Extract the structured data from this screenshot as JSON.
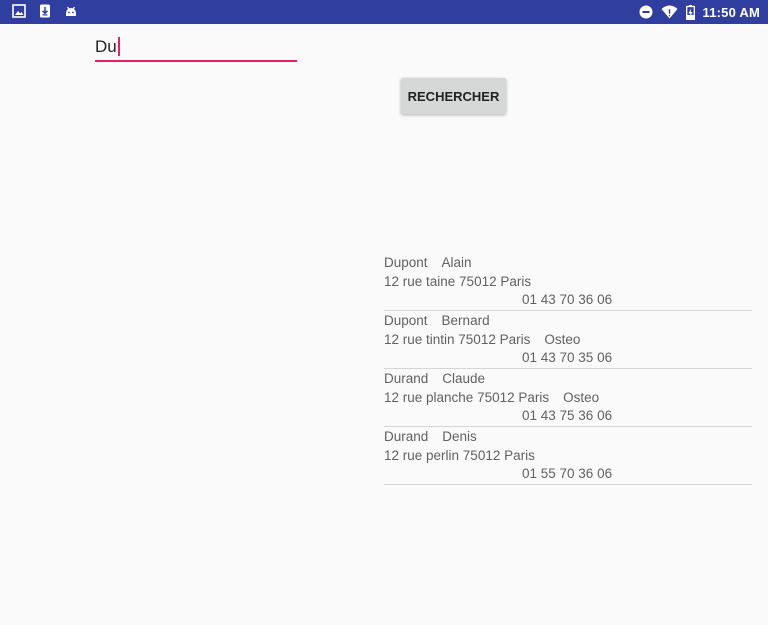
{
  "status_bar": {
    "time": "11:50 AM",
    "left_icons": [
      "image-icon",
      "download-icon",
      "android-icon"
    ],
    "right_icons": [
      "do-not-disturb-icon",
      "wifi-icon",
      "battery-charging-icon"
    ]
  },
  "search": {
    "value": "Du",
    "placeholder": ""
  },
  "button": {
    "label": "RECHERCHER"
  },
  "results": [
    {
      "last_name": "Dupont",
      "first_name": "Alain",
      "address": "12 rue taine 75012 Paris",
      "specialty": "",
      "phone": "01 43 70 36 06"
    },
    {
      "last_name": "Dupont",
      "first_name": "Bernard",
      "address": "12 rue tintin 75012 Paris",
      "specialty": "Osteo",
      "phone": "01 43 70 35 06"
    },
    {
      "last_name": "Durand",
      "first_name": "Claude",
      "address": "12 rue planche 75012 Paris",
      "specialty": "Osteo",
      "phone": "01 43 75 36 06"
    },
    {
      "last_name": "Durand",
      "first_name": "Denis",
      "address": "12 rue perlin 75012 Paris",
      "specialty": "",
      "phone": "01 55 70 36 06"
    }
  ],
  "colors": {
    "status_bar": "#303f9f",
    "accent": "#e91e63",
    "background": "#fafafa",
    "button": "#d6d7d7",
    "list_text": "#616161",
    "divider": "#d5d5d5"
  }
}
